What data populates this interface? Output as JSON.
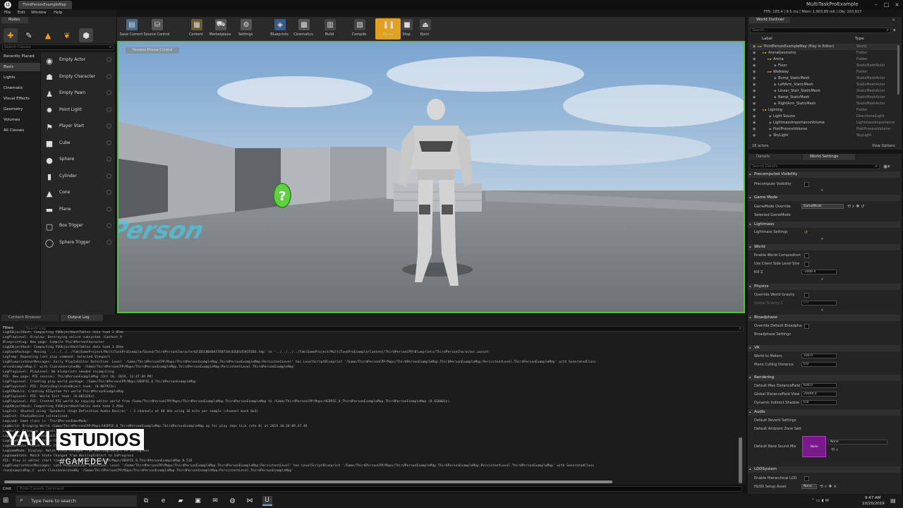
{
  "window": {
    "tab_title": "ThirdPersonExampleMap",
    "app_title": "MultiTaskProExample",
    "stats": "FPS: 105.4 | 9.5 ms | Mem: 1,903.89 mb | Obj: 103,917"
  },
  "menubar": [
    "File",
    "Edit",
    "Window",
    "Help"
  ],
  "modes": {
    "tab": "Modes",
    "icons": [
      "paint-icon",
      "brush-icon",
      "foliage-icon",
      "landscape-icon",
      "mesh-paint-icon"
    ]
  },
  "place": {
    "search_placeholder": "Search Classes",
    "categories": [
      "Recently Placed",
      "Basic",
      "Lights",
      "Cinematic",
      "Visual Effects",
      "Geometry",
      "Volumes",
      "All Classes"
    ],
    "selected_category": "Basic",
    "items": [
      {
        "label": "Empty Actor",
        "icon": "empty-actor-icon",
        "glyph": "◉"
      },
      {
        "label": "Empty Character",
        "icon": "character-icon",
        "glyph": "☗"
      },
      {
        "label": "Empty Pawn",
        "icon": "pawn-icon",
        "glyph": "♟"
      },
      {
        "label": "Point Light",
        "icon": "point-light-icon",
        "glyph": "✹"
      },
      {
        "label": "Player Start",
        "icon": "player-start-icon",
        "glyph": "⚑"
      },
      {
        "label": "Cube",
        "icon": "cube-icon",
        "glyph": "■"
      },
      {
        "label": "Sphere",
        "icon": "sphere-icon",
        "glyph": "●"
      },
      {
        "label": "Cylinder",
        "icon": "cylinder-icon",
        "glyph": "▮"
      },
      {
        "label": "Cone",
        "icon": "cone-icon",
        "glyph": "▲"
      },
      {
        "label": "Plane",
        "icon": "plane-icon",
        "glyph": "▬"
      },
      {
        "label": "Box Trigger",
        "icon": "box-trigger-icon",
        "glyph": "▢"
      },
      {
        "label": "Sphere Trigger",
        "icon": "sphere-trigger-icon",
        "glyph": "◯"
      }
    ]
  },
  "toolbar": {
    "buttons": [
      {
        "label": "Save Current",
        "icon": "save-icon",
        "glyph": "▤",
        "color": "#4a6b8a"
      },
      {
        "label": "Source Control",
        "icon": "source-control-icon",
        "glyph": "⛁",
        "color": "#555555"
      },
      {
        "label": "Content",
        "icon": "content-icon",
        "glyph": "▦",
        "color": "#6a5a3a"
      },
      {
        "label": "Marketplace",
        "icon": "marketplace-icon",
        "glyph": "⛟",
        "color": "#555555"
      },
      {
        "label": "Settings",
        "icon": "settings-icon",
        "glyph": "⚙",
        "color": "#555555"
      },
      {
        "label": "Blueprints",
        "icon": "blueprints-icon",
        "glyph": "◈",
        "color": "#3a5a8a"
      },
      {
        "label": "Cinematics",
        "icon": "cinematics-icon",
        "glyph": "▩",
        "color": "#555555"
      },
      {
        "label": "Build",
        "icon": "build-icon",
        "glyph": "▥",
        "color": "#444444"
      },
      {
        "label": "Compile",
        "icon": "compile-icon",
        "glyph": "▧",
        "color": "#444444"
      },
      {
        "label": "Pause",
        "icon": "pause-icon",
        "glyph": "❚❚",
        "color": "#e0a020"
      },
      {
        "label": "Stop",
        "icon": "stop-icon",
        "glyph": "■",
        "color": "#444444"
      },
      {
        "label": "Eject",
        "icon": "eject-icon",
        "glyph": "⏏",
        "color": "#444444"
      }
    ]
  },
  "viewport": {
    "badge": "Possess Mouse Control",
    "floor_text": "Third Person",
    "border_color": "#55c040"
  },
  "outliner": {
    "tab": "World Outliner",
    "search_placeholder": "Search...",
    "col_label": "Label",
    "col_type": "Type",
    "rows": [
      {
        "name": "ThirdPersonExampleMap (Play In Editor)",
        "type": "World",
        "indent": 0
      },
      {
        "name": "ArenaGeometry",
        "type": "Folder",
        "indent": 1
      },
      {
        "name": "Arena",
        "type": "Folder",
        "indent": 2
      },
      {
        "name": "Floor",
        "type": "StaticMeshActor",
        "indent": 3
      },
      {
        "name": "Walkway",
        "type": "Folder",
        "indent": 2
      },
      {
        "name": "Bump_StaticMesh",
        "type": "StaticMeshActor",
        "indent": 3
      },
      {
        "name": "LeftArm_StaticMesh",
        "type": "StaticMeshActor",
        "indent": 3
      },
      {
        "name": "Linear_Stair_StaticMesh",
        "type": "StaticMeshActor",
        "indent": 3
      },
      {
        "name": "Ramp_StaticMesh",
        "type": "StaticMeshActor",
        "indent": 3
      },
      {
        "name": "RightArm_StaticMesh",
        "type": "StaticMeshActor",
        "indent": 3
      },
      {
        "name": "Lighting",
        "type": "Folder",
        "indent": 1
      },
      {
        "name": "Light Source",
        "type": "DirectionalLight",
        "indent": 2
      },
      {
        "name": "LightmassImportanceVolume",
        "type": "LightmassImportance",
        "indent": 2
      },
      {
        "name": "PostProcessVolume",
        "type": "PostProcessVolume",
        "indent": 2
      },
      {
        "name": "SkyLight",
        "type": "SkyLight",
        "indent": 2
      }
    ],
    "actor_count": "28 actors",
    "view_options": "View Options"
  },
  "details": {
    "tab_details": "Details",
    "tab_world": "World Settings",
    "search_placeholder": "Search Details",
    "sections": {
      "precomputed": "Precomputed Visibility",
      "gamemode": "Game Mode",
      "lightmass": "Lightmass",
      "world": "World",
      "physics": "Physics",
      "broadphase": "Broadphase",
      "vr": "VR",
      "rendering": "Rendering",
      "audio": "Audio",
      "lod": "LODSystem"
    },
    "props": {
      "precompute_visibility": "Precompute Visibility",
      "gamemode_override": "GameMode Override",
      "gamemode_value": "GameMode",
      "selected_gamemode": "Selected GameMode",
      "lightmass_settings": "Lightmass Settings",
      "enable_world_comp": "Enable World Composition",
      "client_streaming": "Use Client Side Level Stre",
      "kill_z": "Kill Z",
      "kill_z_value": "-1000.0",
      "override_gravity": "Override World Gravity",
      "global_gravity": "Global Gravity Z",
      "global_gravity_value": "0.0",
      "override_broadphase": "Override Default Broadpha",
      "broadphase_settings": "Broadphase Settings",
      "world_to_meters": "World to Meters",
      "world_to_meters_value": "100.0",
      "mono_culling": "Mono Culling Distance",
      "mono_culling_value": "0.0",
      "max_distance_field": "Default Max DistanceField",
      "max_distance_value": "600.0",
      "global_distance_field": "Global DistanceField View",
      "global_distance_value": "20000.0",
      "dynamic_indirect": "Dynamic Indirect Shadow",
      "dynamic_indirect_value": "0.8",
      "reverb": "Default Reverb Settings",
      "ambient_zone": "Default Ambient Zone Sett",
      "base_sound_mix": "Default Base Sound Mix",
      "base_sound_value": "None",
      "sound_mix_thumb": "None",
      "hierarchical_lod": "Enable Hierarchical LOD",
      "hlod_setup": "HLOD Setup Asset",
      "hlod_value": "None"
    }
  },
  "bottom": {
    "tab_content": "Content Browser",
    "tab_output": "Output Log",
    "filters": "Filters",
    "search_placeholder": "Search Log",
    "log_lines": [
      "LogUObjectHash: Compacting FUObjectHashTables data took   2.85ms",
      "LogPlayLevel: Display: Destroying online subsystem :Context_9",
      "BlueprintLog: New page: Compile ThirdPersonCharacter",
      "LogUObjectHash: Compacting FUObjectHashTables data took   3.66ms",
      "LogSavePackage: Moving '../../../../YakiGameProject/MultiTaskProExample/Saved/ThirdPersonCharacter021B1C8B404F35B734C41681458151B3.tmp' to '../../../../YakiGameProject/MultiTaskProExample/Content/ThirdPersonCPP/Blueprints/ThirdPersonCharacter.uasset'",
      "LogTemp: Repeating last play command: Selected Viewport",
      "LogBlueprintUserMessages: Early PlayInEditor Detection: Level '/Game/ThirdPersonCPP/Maps/ThirdPersonExampleMap.ThirdPersonExampleMap:PersistentLevel' has LevelScriptBlueprint '/Game/ThirdPersonCPP/Maps/ThirdPersonExampleMap.ThirdPersonExampleMap:PersistentLevel.ThirdPersonExampleMap' with GeneratedClass",
      "ersonExampleMap_C' with ClassGeneratedBy '/Game/ThirdPersonCPP/Maps/ThirdPersonExampleMap.ThirdPersonExampleMap:PersistentLevel.ThirdPersonExampleMap'",
      "LogPlayLevel: PlayLevel: No blueprints needed recompiling",
      "PIE: New page: PIE session: ThirdPersonExampleMap (Oct 20, 2019, 12:47:49 PM)",
      "LogPlayLevel: Creating play world package: /Game/ThirdPersonCPP/Maps/UEDPIE_0_ThirdPersonExampleMap",
      "LogPlayLevel: PIE: StaticDuplicateObject took: (0.007923s)",
      "LogAIModule: Creating AISystem for world ThirdPersonExampleMap",
      "LogPlayLevel: PIE: World Init took: (0.001326s)",
      "LogPlayLevel: PIE: Created PIE world by copying editor world from /Game/ThirdPersonCPP/Maps/ThirdPersonExampleMap.ThirdPersonExampleMap to /Game/ThirdPersonCPP/Maps/UEDPIE_0_ThirdPersonExampleMap.ThirdPersonExampleMap (0.010001s)",
      "LogUObjectHash: Compacting FUObjectHashTables data took   3.29ms",
      "LogInit: XAudio2 using 'Speakers (High Definition Audio Device)' : 2 channels at 48 kHz using 16 bits per sample (channel mask 0x3)",
      "LogInit: FAudioDevice initialized.",
      "LogLoad: Game class is 'ThirdPersonGameMode'",
      "LogWorld: Bringing World /Game/ThirdPersonCPP/Maps/UEDPIE_0_ThirdPersonExampleMap.ThirdPersonExampleMap up for play (max tick rate 0) at 2019.10.20-09.47.49",
      "LogWorld: Bringing up level for play took: 0.001105",
      "LogOnline: OSS: Created online subsystem instance for: :Context_10",
      "LogGameState: Match State Changed from EnteringMap to WaitingToStart",
      "LogGameState: Match State Changed from WaitingToStart to InProgress",
      "LogGameMode: Display: Match State Changed from WaitingToStart to InProgress",
      "LogGameState: Match State Changed from WaitingToStart to InProgress",
      "PIE: Play in editor start time for /Game/ThirdPersonCPP/Maps/UEDPIE_0_ThirdPersonExampleMap 0.518",
      "LogBlueprintUserMessages: Late PlayInEditor Detection: Level '/Game/ThirdPersonCPP/Maps/ThirdPersonExampleMap.ThirdPersonExampleMap:PersistentLevel' has LevelScriptBlueprint '/Game/ThirdPersonCPP/Maps/ThirdPersonExampleMap.ThirdPersonExampleMap:PersistentLevel.ThirdPersonExampleMap' with GeneratedClass",
      "rsonExampleMap_C' with ClassGeneratedBy '/Game/ThirdPersonCPP/Maps/ThirdPersonExampleMap.ThirdPersonExampleMap:PersistentLevel.ThirdPersonExampleMap'"
    ],
    "cmd_label": "Cmd",
    "cmd_placeholder": "Enter Console Command"
  },
  "watermark": {
    "brand": "YAKI",
    "studios": "STUDIOS",
    "tagline": "#GAMEDEV"
  },
  "taskbar": {
    "search_placeholder": "Type here to search",
    "time": "9:47 AM",
    "date": "10/20/2019",
    "apps": [
      {
        "icon": "task-view-icon",
        "glyph": "⧉"
      },
      {
        "icon": "edge-icon",
        "glyph": "e"
      },
      {
        "icon": "file-explorer-icon",
        "glyph": "▰"
      },
      {
        "icon": "store-icon",
        "glyph": "▣"
      },
      {
        "icon": "mail-icon",
        "glyph": "✉"
      },
      {
        "icon": "chrome-icon",
        "glyph": "◍"
      },
      {
        "icon": "visual-studio-icon",
        "glyph": "⋈"
      },
      {
        "icon": "unreal-icon",
        "glyph": "U"
      }
    ]
  }
}
